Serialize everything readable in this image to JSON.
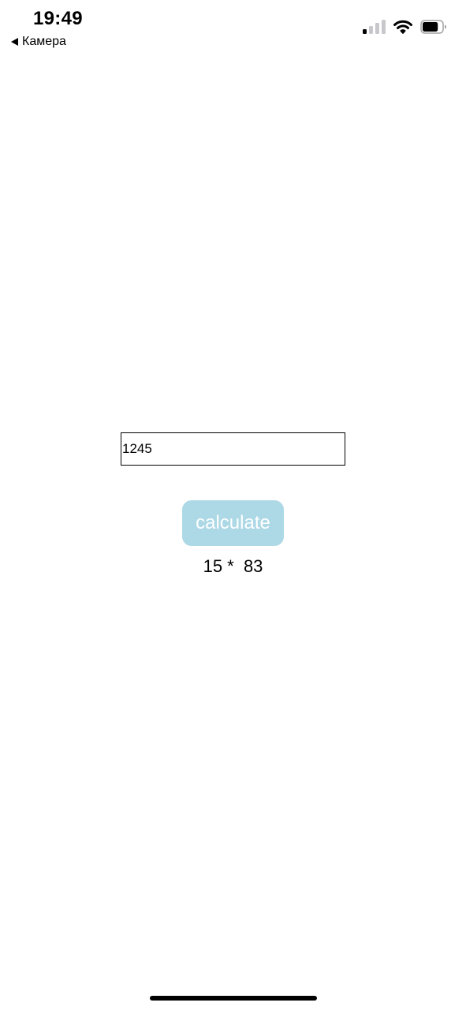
{
  "status_bar": {
    "time": "19:49",
    "back_label": "Камера",
    "signal_bars_active": 1,
    "signal_bars_total": 4,
    "battery_level": 0.8
  },
  "form": {
    "input_value": "1245",
    "button_label": "calculate"
  },
  "result": {
    "text": "15 *  83"
  },
  "colors": {
    "button_background": "#add8e6",
    "button_text": "#ffffff",
    "signal_active": "#000000",
    "signal_inactive": "#c7c7cc"
  }
}
